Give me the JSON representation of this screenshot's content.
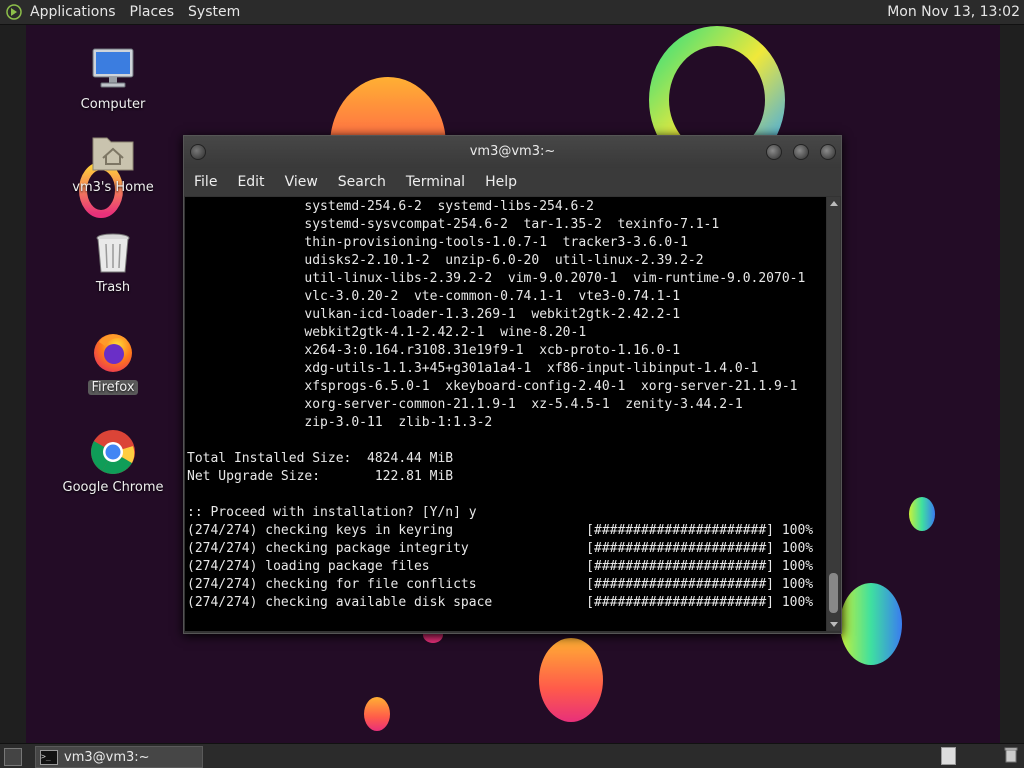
{
  "top_panel": {
    "menus": [
      "Applications",
      "Places",
      "System"
    ],
    "clock": "Mon Nov 13, 13:02"
  },
  "desktop_icons": [
    {
      "label": "Computer",
      "icon": "computer-icon"
    },
    {
      "label": "vm3's Home",
      "icon": "home-folder-icon"
    },
    {
      "label": "Trash",
      "icon": "trash-icon"
    },
    {
      "label": "Firefox",
      "icon": "firefox-icon",
      "selected": true
    },
    {
      "label": "Google Chrome",
      "icon": "chrome-icon"
    }
  ],
  "terminal": {
    "title": "vm3@vm3:~",
    "menu": [
      "File",
      "Edit",
      "View",
      "Search",
      "Terminal",
      "Help"
    ],
    "lines": [
      "               systemd-254.6-2  systemd-libs-254.6-2",
      "               systemd-sysvcompat-254.6-2  tar-1.35-2  texinfo-7.1-1",
      "               thin-provisioning-tools-1.0.7-1  tracker3-3.6.0-1",
      "               udisks2-2.10.1-2  unzip-6.0-20  util-linux-2.39.2-2",
      "               util-linux-libs-2.39.2-2  vim-9.0.2070-1  vim-runtime-9.0.2070-1",
      "               vlc-3.0.20-2  vte-common-0.74.1-1  vte3-0.74.1-1",
      "               vulkan-icd-loader-1.3.269-1  webkit2gtk-2.42.2-1",
      "               webkit2gtk-4.1-2.42.2-1  wine-8.20-1",
      "               x264-3:0.164.r3108.31e19f9-1  xcb-proto-1.16.0-1",
      "               xdg-utils-1.1.3+45+g301a1a4-1  xf86-input-libinput-1.4.0-1",
      "               xfsprogs-6.5.0-1  xkeyboard-config-2.40-1  xorg-server-21.1.9-1",
      "               xorg-server-common-21.1.9-1  xz-5.4.5-1  zenity-3.44.2-1",
      "               zip-3.0-11  zlib-1:1.3-2",
      "",
      "Total Installed Size:  4824.44 MiB",
      "Net Upgrade Size:       122.81 MiB",
      "",
      ":: Proceed with installation? [Y/n] y",
      "(274/274) checking keys in keyring                 [######################] 100%",
      "(274/274) checking package integrity               [######################] 100%",
      "(274/274) loading package files                    [######################] 100%",
      "(274/274) checking for file conflicts              [######################] 100%",
      "(274/274) checking available disk space            [######################] 100%"
    ]
  },
  "taskbar": {
    "task_label": "vm3@vm3:~",
    "task_icon_text": ">_"
  },
  "colors": {
    "desktop_bg": "#230c26",
    "panel_bg": "#2b2b2b",
    "terminal_bg": "#000000"
  }
}
